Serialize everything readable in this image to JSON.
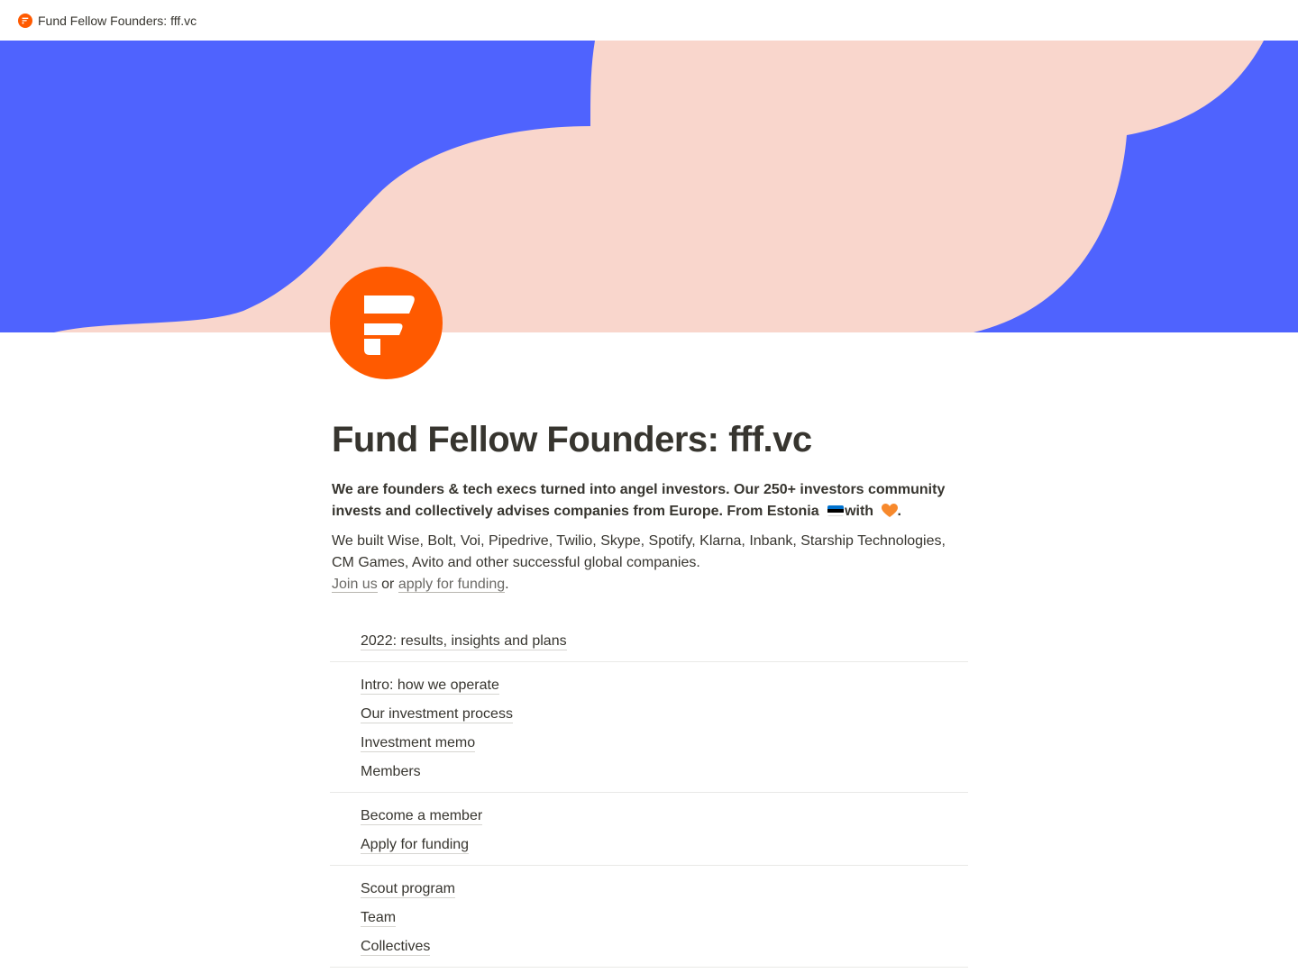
{
  "browser": {
    "tab_title": "Fund Fellow Founders: fff.vc"
  },
  "colors": {
    "brand_orange": "#ff5a00",
    "cover_blue": "#4f63fe",
    "cover_pink": "#f9d6cc",
    "text": "#37352f"
  },
  "page": {
    "icon": "fff-logo-icon",
    "title": "Fund Fellow Founders: fff.vc",
    "intro_bold_1": "We are founders & tech execs turned into angel investors. Our 250+ investors community invests and collectively advises companies from Europe. From Estonia",
    "intro_bold_2": "with",
    "intro_bold_3": ".",
    "intro_text": "We built Wise, Bolt, Voi, Pipedrive, Twilio, Skype, Spotify, Klarna, Inbank, Starship Technologies, CM Games, Avito and other successful global companies.",
    "join_link": "Join us",
    "or_text": " or ",
    "apply_link": "apply for funding",
    "end_period": "."
  },
  "nav_groups": [
    {
      "items": [
        {
          "label": "2022: results, insights and plans"
        }
      ]
    },
    {
      "items": [
        {
          "label": "Intro: how we operate"
        },
        {
          "label": "Our investment process"
        },
        {
          "label": "Investment memo"
        },
        {
          "label": "Members"
        }
      ]
    },
    {
      "items": [
        {
          "label": "Become a member"
        },
        {
          "label": "Apply for funding"
        }
      ]
    },
    {
      "items": [
        {
          "label": "Scout program"
        },
        {
          "label": "Team"
        },
        {
          "label": "Collectives"
        }
      ]
    }
  ]
}
